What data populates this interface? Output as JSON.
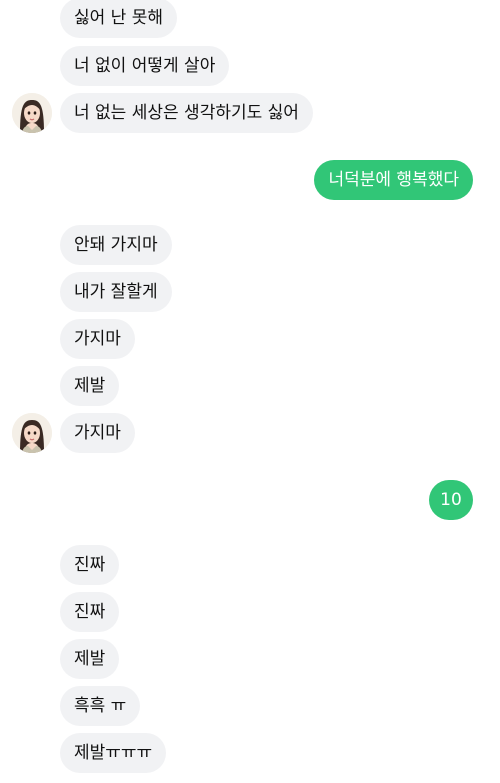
{
  "messages": [
    {
      "text": "싫어 난 못해"
    },
    {
      "text": "너 없이 어떻게 살아"
    },
    {
      "text": "너 없는 세상은 생각하기도 싫어"
    },
    {
      "text": "너덕분에 행복했다"
    },
    {
      "text": "안돼 가지마"
    },
    {
      "text": "내가 잘할게"
    },
    {
      "text": "가지마"
    },
    {
      "text": "제발"
    },
    {
      "text": "가지마"
    },
    {
      "text": "10"
    },
    {
      "text": "진짜"
    },
    {
      "text": "진짜"
    },
    {
      "text": "제발"
    },
    {
      "text": "흑흑 ㅠ"
    },
    {
      "text": "제발ㅠㅠㅠ"
    }
  ],
  "avatar": {
    "icon": "girl-portrait-icon"
  },
  "colors": {
    "incoming_bubble": "#f1f2f4",
    "outgoing_bubble": "#31c677"
  }
}
